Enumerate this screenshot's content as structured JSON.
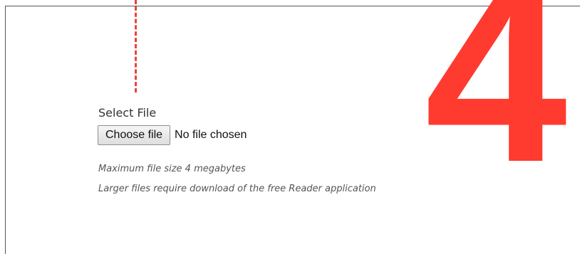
{
  "step": {
    "number": "4",
    "accent_color": "#ff3b30"
  },
  "upload": {
    "label": "Select File",
    "button_label": "Choose file",
    "status_text": "No file chosen",
    "notes": [
      "Maximum file size 4 megabytes",
      "Larger files require download of the free Reader application"
    ]
  }
}
